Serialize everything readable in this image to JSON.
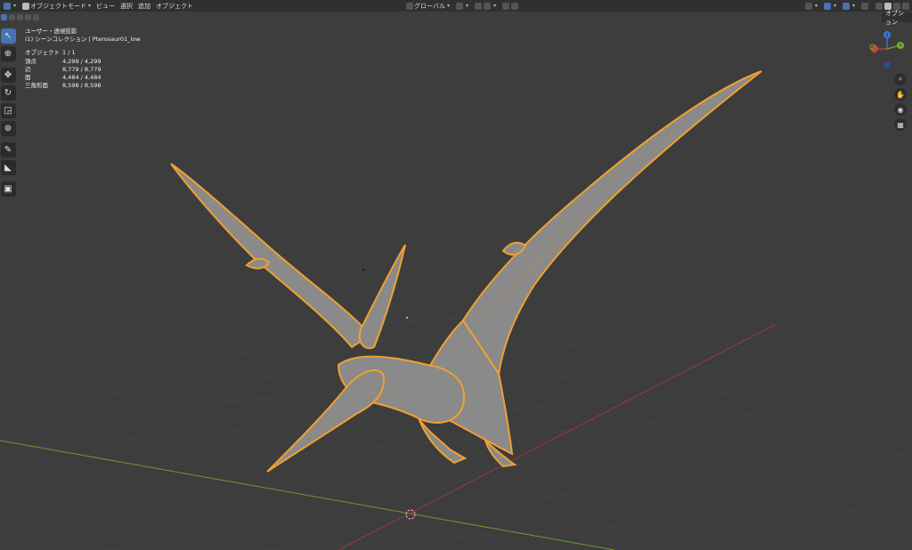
{
  "header": {
    "mode_label": "オブジェクトモード",
    "menus": [
      "ビュー",
      "選択",
      "追加",
      "オブジェクト"
    ],
    "transform_orientation": "グローバル",
    "options_tab": "オプション"
  },
  "viewport_info": {
    "view_name": "ユーザー・透視投影",
    "collection_line": "(1) シーンコレクション | Pterosaur01_low",
    "stats": [
      {
        "label": "オブジェクト",
        "value": "1 / 1"
      },
      {
        "label": "頂点",
        "value": "4,299 / 4,299"
      },
      {
        "label": "辺",
        "value": "8,779 / 8,779"
      },
      {
        "label": "面",
        "value": "4,484 / 4,484"
      },
      {
        "label": "三角形面",
        "value": "8,598 / 8,598"
      }
    ]
  },
  "gizmo": {
    "z": "Z",
    "y": "Y",
    "x": "X"
  },
  "colors": {
    "background": "#3d3d3d",
    "selection_outline": "#f0a030",
    "mesh_fill": "#8a8a8a",
    "x_axis": "#9a3a3a",
    "y_axis": "#6a9a3a",
    "accent": "#4772b3"
  },
  "icons": {
    "tools": [
      "select-box-icon",
      "cursor-icon",
      "move-icon",
      "rotate-icon",
      "scale-icon",
      "transform-icon",
      "annotate-icon",
      "measure-icon",
      "add-cube-icon"
    ],
    "navigation": [
      "zoom-icon",
      "hand-pan-icon",
      "camera-icon",
      "grid-ortho-icon"
    ]
  }
}
